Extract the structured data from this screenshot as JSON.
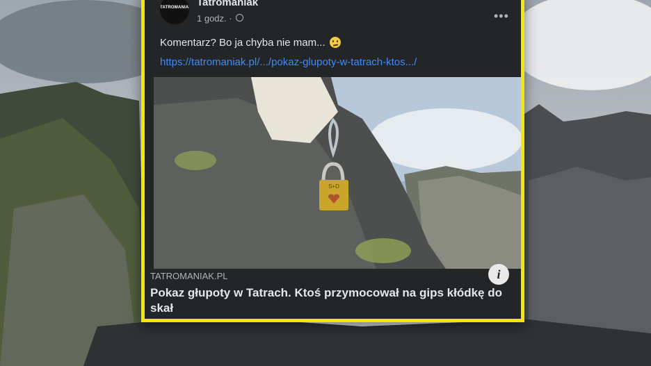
{
  "post": {
    "page_name": "Tatromaniak",
    "avatar_text": "TATROMANIAK",
    "time": "1 godz. ·",
    "more": "•••",
    "text": "Komentarz? Bo ja chyba nie mam...",
    "link": "https://tatromaniak.pl/.../pokaz-glupoty-w-tatrach-ktos.../",
    "lock_text": "S+D",
    "preview": {
      "domain": "TATROMANIAK.PL",
      "headline": "Pokaz głupoty w Tatrach. Ktoś przymocował na gips kłódkę do skał",
      "info_icon": "i"
    }
  },
  "colors": {
    "highlight_border": "#f5e60a",
    "card_bg": "#242526",
    "link": "#3d8bfd"
  }
}
